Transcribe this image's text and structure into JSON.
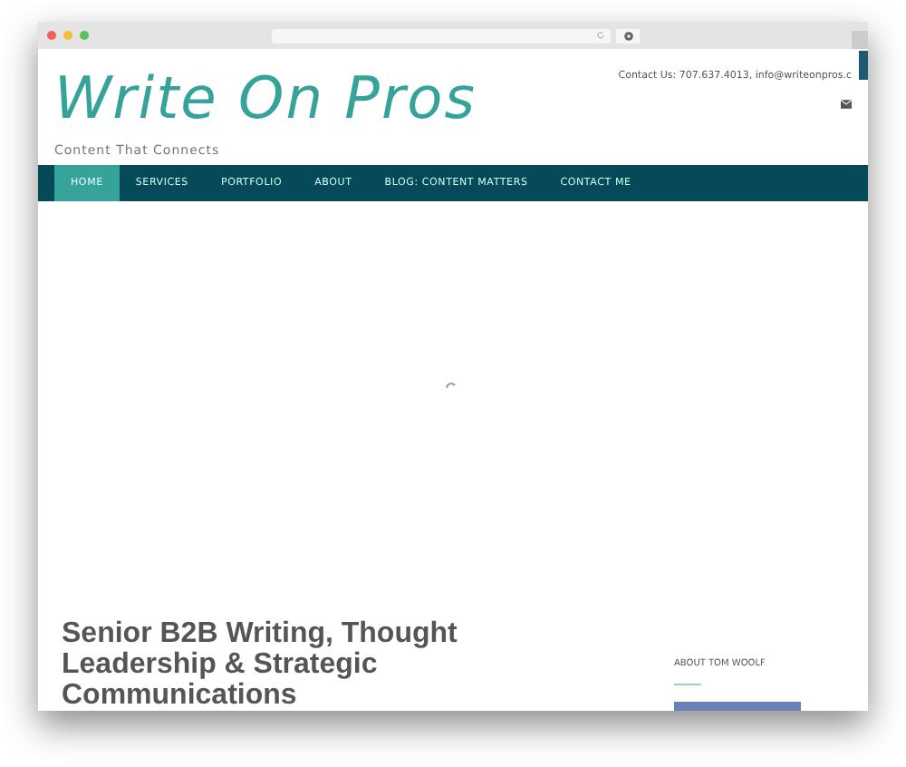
{
  "site": {
    "logo": "Write On Pros",
    "tagline": "Content That Connects",
    "contact": "Contact Us: 707.637.4013, info@writeonpros.c"
  },
  "nav": [
    {
      "label": "HOME",
      "selected": true
    },
    {
      "label": "SERVICES",
      "selected": false
    },
    {
      "label": "PORTFOLIO",
      "selected": false
    },
    {
      "label": "ABOUT",
      "selected": false
    },
    {
      "label": "BLOG: CONTENT MATTERS",
      "selected": false
    },
    {
      "label": "CONTACT ME",
      "selected": false
    }
  ],
  "main": {
    "heading": "Senior B2B Writing, Thought Leadership & Strategic Communications"
  },
  "sidebar": {
    "title": "ABOUT TOM WOOLF"
  }
}
